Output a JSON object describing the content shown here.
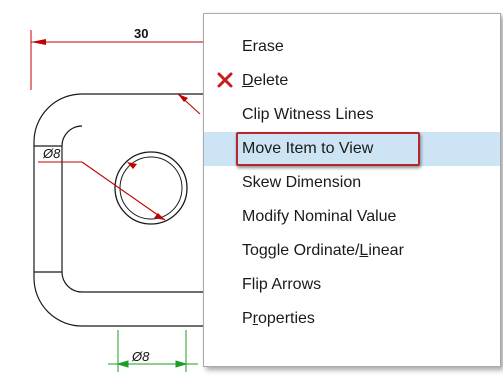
{
  "drawing": {
    "dim_top": "30",
    "dim_hole": "Ø8",
    "dim_bottom": "Ø8"
  },
  "colors": {
    "menu_highlight": "#cde4f4",
    "callout_border": "#b5262f",
    "delete_icon": "#c41f1f",
    "dimension_red": "#c00000",
    "dimension_green": "#1c9e25"
  },
  "context_menu": {
    "items": [
      {
        "label": "Erase"
      },
      {
        "icon": "delete-x-icon",
        "mnemonic": "D",
        "rest": "elete"
      },
      {
        "label": "Clip Witness Lines"
      },
      {
        "label": "Move Item to View",
        "highlighted": true
      },
      {
        "label": "Skew Dimension"
      },
      {
        "label": "Modify Nominal Value"
      },
      {
        "pre": "Toggle Ordinate/",
        "mnemonic": "L",
        "rest": "inear"
      },
      {
        "label": "Flip Arrows"
      },
      {
        "pre": "P",
        "mnemonic": "r",
        "rest": "operties"
      }
    ]
  }
}
